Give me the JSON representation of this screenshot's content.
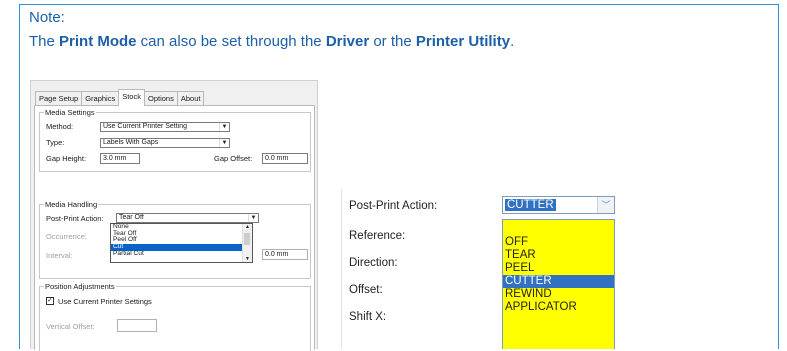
{
  "note": {
    "title": "Note:",
    "text_pre": "The ",
    "bold1": "Print Mode",
    "text_mid1": " can also be set through the ",
    "bold2": "Driver",
    "text_mid2": " or the ",
    "bold3": "Printer Utility",
    "text_end": "."
  },
  "dialog": {
    "tabs": [
      "Page Setup",
      "Graphics",
      "Stock",
      "Options",
      "About"
    ],
    "active_tab": "Stock",
    "media_settings": {
      "title": "Media Settings",
      "method_label": "Method:",
      "method_value": "Use Current Printer Setting",
      "type_label": "Type:",
      "type_value": "Labels With Gaps",
      "gap_height_label": "Gap Height:",
      "gap_height_value": "3.0 mm",
      "gap_offset_label": "Gap Offset:",
      "gap_offset_value": "0.0 mm"
    },
    "media_handling": {
      "title": "Media Handling",
      "post_print_label": "Post-Print Action:",
      "post_print_value": "Tear Off",
      "occurrence_label": "Occurrence:",
      "interval_label": "Interval:",
      "interval_value": "0.0 mm",
      "options": [
        "None",
        "Tear Off",
        "Peel Off",
        "Cut",
        "Partial Cut"
      ],
      "selected_option": "Cut"
    },
    "position_adjustments": {
      "title": "Position Adjustments",
      "use_current_label": "Use Current Printer Settings",
      "use_current_checked": true,
      "vertical_offset_label": "Vertical Offset:"
    }
  },
  "panel": {
    "post_print_label": "Post-Print Action:",
    "post_print_value": "CUTTER",
    "reference_label": "Reference:",
    "direction_label": "Direction:",
    "offset_label": "Offset:",
    "shift_label": "Shift X:",
    "options": [
      "OFF",
      "TEAR",
      "PEEL",
      "CUTTER",
      "REWIND",
      "APPLICATOR"
    ],
    "selected_option": "CUTTER",
    "highlight_color": "#ffff00",
    "selection_color": "#3071c2"
  }
}
